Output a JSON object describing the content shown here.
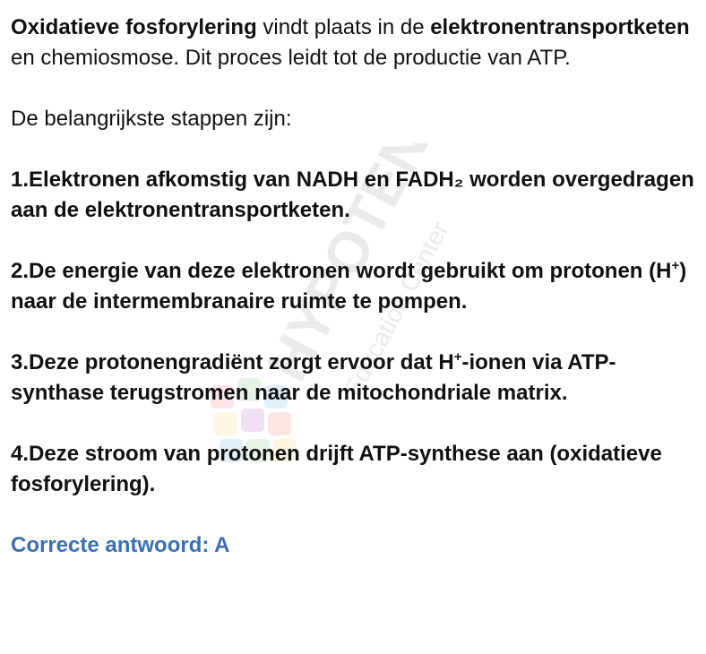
{
  "intro": {
    "term1": "Oxidatieve fosforylering",
    "text1": " vindt plaats in de ",
    "term2": "elektronentransportketen",
    "text2": " en chemiosmose. Dit proces leidt tot de productie van ATP."
  },
  "steps_heading": "De belangrijkste stappen zijn:",
  "steps": [
    {
      "a": "1.Elektronen afkomstig van NADH en FADH₂ worden overgedragen aan de elektronentransportketen."
    },
    {
      "a": "2.De energie van deze elektronen wordt gebruikt om protonen (H",
      "sup": "+",
      "b": ") naar de intermembranaire ruimte te pompen."
    },
    {
      "a": "3.Deze protonengradiënt zorgt ervoor dat H",
      "sup": "+",
      "b": "-ionen via ATP-synthase terugstromen naar de mitochondriale matrix."
    },
    {
      "a": "4.Deze stroom van protonen drijft ATP-synthese aan (oxidatieve fosforylering)."
    }
  ],
  "answer": "Correcte antwoord: A",
  "watermark": {
    "brand": "HYPOTENUSE",
    "subtitle": "Education Center",
    "colors": [
      "#e53935",
      "#43a047",
      "#1e88e5",
      "#fbc02d",
      "#8e24aa"
    ]
  },
  "colors": {
    "text": "#111111",
    "answer": "#3a6fb5"
  }
}
